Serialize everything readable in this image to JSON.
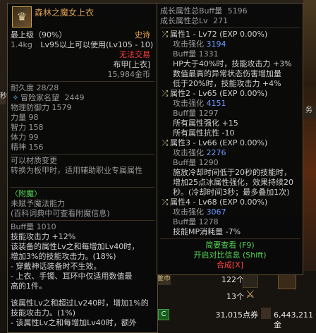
{
  "left_tooltip": {
    "item_name": "森林之魔女上衣",
    "level": "最上级（90%）",
    "rarity": "史诗",
    "weight": "1.4kg",
    "requirement": "Lv95以上可以使用(Lv105 - 10)",
    "trade": "无法交易",
    "armor_type": "布甲[上衣]",
    "price": "15,984金币",
    "durability": "耐久度 28/28",
    "adventurer_rep_label": "冒险家名望",
    "adventurer_rep_value": "2449",
    "stats": [
      {
        "name": "物理防御力",
        "value": "1579"
      },
      {
        "name": "力量",
        "value": "98"
      },
      {
        "name": "智力",
        "value": "158"
      },
      {
        "name": "体力",
        "value": "99"
      },
      {
        "name": "精神",
        "value": "156"
      }
    ],
    "material_change": "可以材质变更",
    "transfer_text": "转换为板甲时，适用辅助职业专属属性",
    "enchant_header": "〈附魔〉",
    "enchant_none": "未赋予魔法能力",
    "enchant_hint": "(百科词典中可查看附魔信息)",
    "buff_line": "Buff量 1010",
    "effects": [
      "技能攻击力 +12%",
      "该装备的属性Lv之和每增加Lv40时，",
      "增加3%的技能攻击力。(18%)",
      "- 穿戴神话装备时不生效。",
      "- 上衣、手镯、耳环中仅适用数值最",
      "高的1件。"
    ],
    "effects2": [
      "该属性Lv之和超过Lv240时，增加1%的",
      "技能攻击力。(1%)",
      "- 该属性Lv之和每增加Lv40时，额外"
    ]
  },
  "right_tooltip": {
    "growth_buff_label": "成长属性总Buff量",
    "growth_buff_value": "5196",
    "growth_lv_label": "成长属性总Lv",
    "growth_lv_value": "271",
    "attributes": [
      {
        "header": "属性1 - Lv72 (EXP 0.00%)",
        "lines": [
          {
            "text": "攻击强化",
            "value": "3194"
          },
          {
            "text": "Buff量 1331"
          },
          {
            "text": "HP大于40%时，技能攻击力 +3%"
          },
          {
            "text": "数值最高的异常状态伤害增加量"
          },
          {
            "text": "低于20%时，技能攻击力 +4%"
          }
        ]
      },
      {
        "header": "属性2 - Lv65 (EXP 0.00%)",
        "lines": [
          {
            "text": "攻击强化",
            "value": "4151"
          },
          {
            "text": "Buff量 1297"
          },
          {
            "text": "所有属性强化 +15"
          },
          {
            "text": "所有属性抗性 -10"
          }
        ]
      },
      {
        "header": "属性3 - Lv66 (EXP 0.00%)",
        "lines": [
          {
            "text": "攻击强化",
            "value": "2276"
          },
          {
            "text": "Buff量 1290"
          },
          {
            "text": "施放冷却时间低于20秒的技能时，"
          },
          {
            "text": "增加25点冰属性强化，效果持续20"
          },
          {
            "text": "秒。(冷却时间3秒；最多叠加1次)"
          }
        ]
      },
      {
        "header": "属性4 - Lv68 (EXP 0.00%)",
        "lines": [
          {
            "text": "攻击强化",
            "value": "3067"
          },
          {
            "text": "Buff量 1278"
          },
          {
            "text": "技能MP消耗量 -7%"
          }
        ]
      }
    ],
    "brief_view": "简要查看 (F9)",
    "compare_open": "开启对比信息 (Shift)",
    "synthesis": "合成[X]"
  },
  "background": {
    "side_text_1": "秒",
    "side_text_2": "务",
    "bottom_left_label": "金币",
    "count_122": "122个",
    "count_13": "13个",
    "points_label": "31,015点券",
    "gold_label": "6,443,211金"
  },
  "colors": {
    "border": "#5c4e33",
    "title": "#d9c98a",
    "epic": "#e0a050",
    "warning": "#ff4040",
    "blue_value": "#6e9cff",
    "green": "#52d552"
  }
}
